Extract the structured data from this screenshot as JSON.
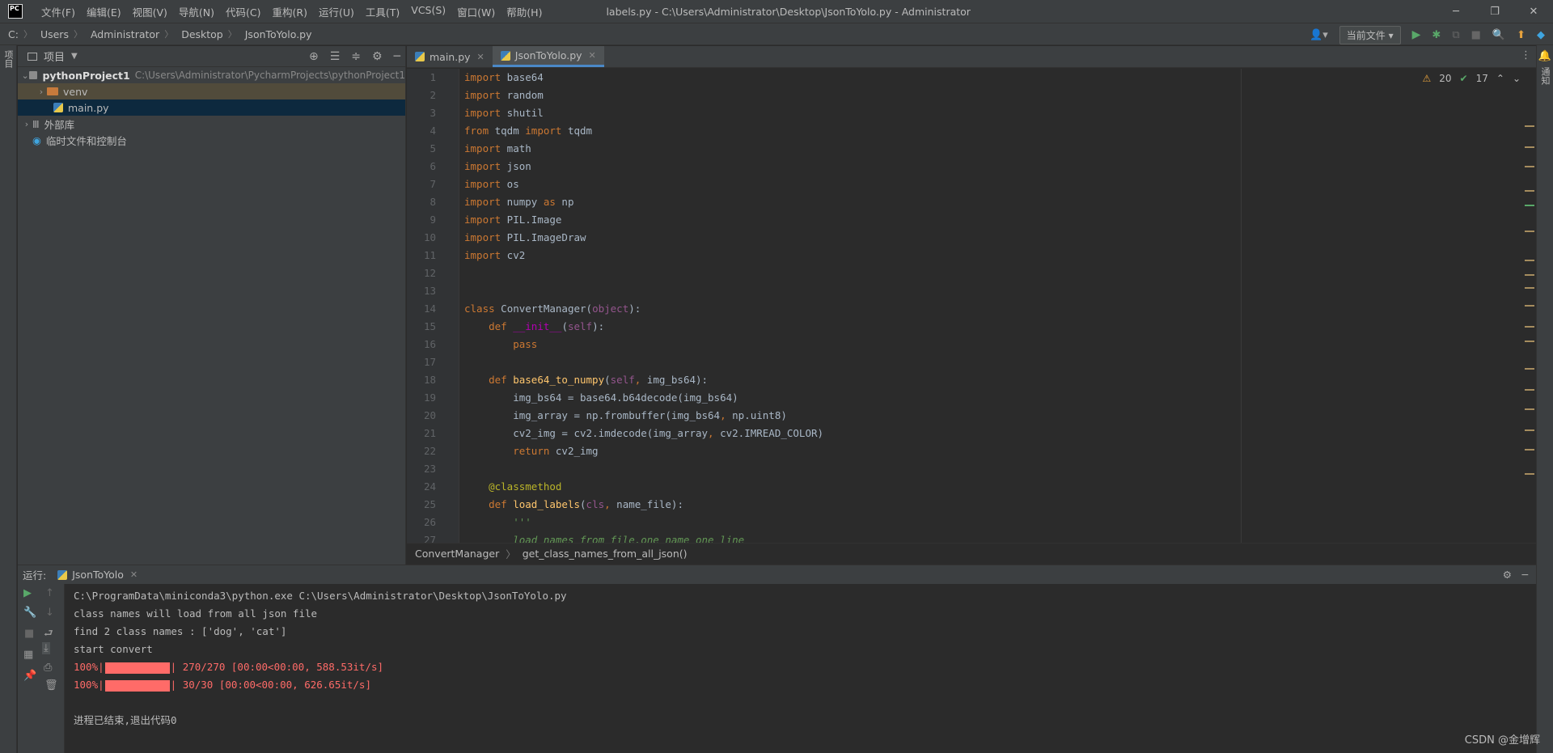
{
  "menu": [
    "文件(F)",
    "编辑(E)",
    "视图(V)",
    "导航(N)",
    "代码(C)",
    "重构(R)",
    "运行(U)",
    "工具(T)",
    "VCS(S)",
    "窗口(W)",
    "帮助(H)"
  ],
  "window_title": "labels.py - C:\\Users\\Administrator\\Desktop\\JsonToYolo.py - Administrator",
  "breadcrumb": [
    "C:",
    "Users",
    "Administrator",
    "Desktop",
    "JsonToYolo.py"
  ],
  "run_config": "当前文件",
  "left_stripe_label": "项目",
  "right_stripe_label": "通知",
  "project": {
    "title": "项目",
    "root_name": "pythonProject1",
    "root_path": "C:\\Users\\Administrator\\PycharmProjects\\pythonProject1",
    "items": [
      "venv",
      "main.py",
      "外部库",
      "临时文件和控制台"
    ]
  },
  "tabs": [
    {
      "label": "main.py"
    },
    {
      "label": "JsonToYolo.py"
    }
  ],
  "inspection": {
    "warnings": "20",
    "weak": "17"
  },
  "line_numbers": [
    "1",
    "2",
    "3",
    "4",
    "5",
    "6",
    "7",
    "8",
    "9",
    "10",
    "11",
    "12",
    "13",
    "14",
    "15",
    "16",
    "17",
    "18",
    "19",
    "20",
    "21",
    "22",
    "23",
    "24",
    "25",
    "26",
    "27"
  ],
  "editor_breadcrumb": [
    "ConvertManager",
    "get_class_names_from_all_json()"
  ],
  "run": {
    "label": "运行:",
    "config_tab": "JsonToYolo",
    "lines": [
      "C:\\ProgramData\\miniconda3\\python.exe C:\\Users\\Administrator\\Desktop\\JsonToYolo.py",
      "class names will load from all json file",
      "find 2 class names : ['dog', 'cat']",
      "start convert"
    ],
    "progress": [
      {
        "pct": "100%|",
        "rest": "| 270/270 [00:00<00:00, 588.53it/s]",
        "fraction": 1.0
      },
      {
        "pct": "100%|",
        "rest": "| 30/30 [00:00<00:00, 626.65it/s]",
        "fraction": 1.0
      }
    ],
    "exit_line": "进程已结束,退出代码0"
  },
  "watermark": "CSDN @金增辉",
  "colors": {
    "keyword": "#cc7832",
    "function": "#ffc66d",
    "self": "#94558d",
    "decorator": "#bbb529",
    "comment": "#629755",
    "progress_red": "#ff6b68",
    "accent": "#4a88c7"
  }
}
